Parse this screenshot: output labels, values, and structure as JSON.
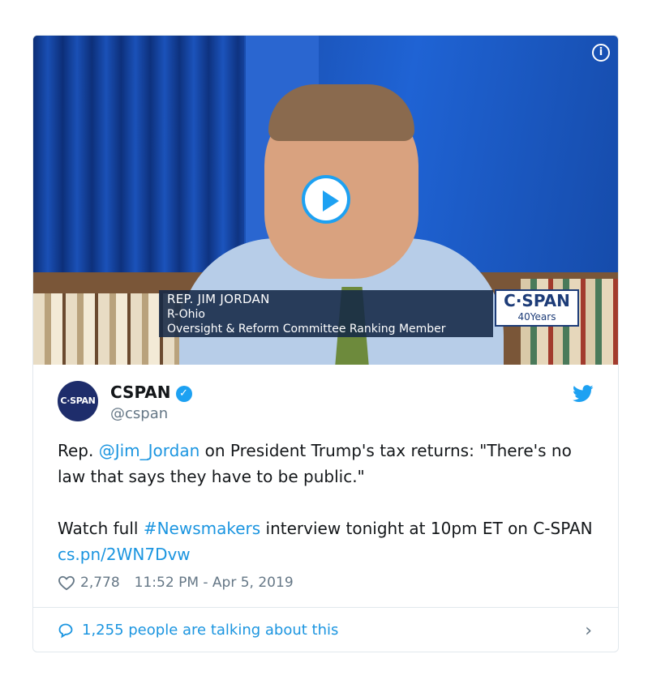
{
  "video": {
    "lower_third": {
      "line1": "REP. JIM JORDAN",
      "line2": "R-Ohio",
      "line3": "Oversight & Reform Committee Ranking Member"
    },
    "network_logo": {
      "name": "C·SPAN",
      "sub": "40Years"
    },
    "info_icon_text": "i"
  },
  "tweet": {
    "avatar_text": "C·SPAN",
    "display_name": "CSPAN",
    "verified_icon": "✓",
    "handle": "@cspan",
    "text": {
      "p1_prefix": "Rep. ",
      "p1_mention": "@Jim_Jordan",
      "p1_rest": " on President Trump's tax returns: \"There's no law that says they have to be public.\"",
      "p2_prefix": "Watch full ",
      "p2_hashtag": "#Newsmakers",
      "p2_middle": " interview tonight at 10pm ET on C-SPAN ",
      "p2_link": "cs.pn/2WN7Dvw"
    },
    "likes": "2,778",
    "timestamp": "11:52 PM - Apr 5, 2019",
    "talking": "1,255 people are talking about this",
    "chevron": "›"
  },
  "colors": {
    "link": "#1b95e0",
    "secondary": "#657786",
    "twitter_blue": "#1da1f2",
    "border": "#e1e8ed"
  }
}
